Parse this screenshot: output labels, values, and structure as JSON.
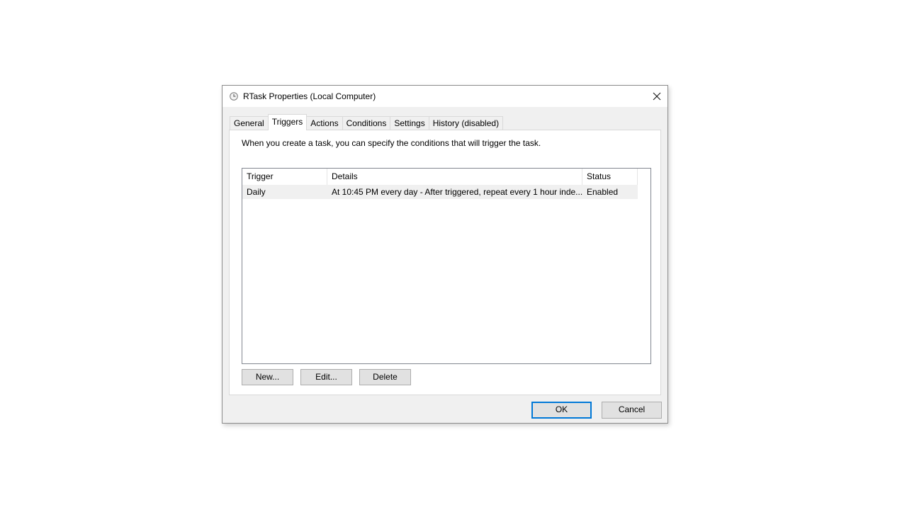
{
  "window": {
    "title": "RTask Properties (Local Computer)",
    "close_symbol": "✕",
    "icon": "clock-icon"
  },
  "tabs": [
    {
      "label": "General",
      "active": false
    },
    {
      "label": "Triggers",
      "active": true
    },
    {
      "label": "Actions",
      "active": false
    },
    {
      "label": "Conditions",
      "active": false
    },
    {
      "label": "Settings",
      "active": false
    },
    {
      "label": "History (disabled)",
      "active": false
    }
  ],
  "triggers_tab": {
    "description": "When you create a task, you can specify the conditions that will trigger the task.",
    "columns": [
      "Trigger",
      "Details",
      "Status"
    ],
    "rows": [
      {
        "trigger": "Daily",
        "details": "At 10:45 PM every day - After triggered, repeat every 1 hour inde...",
        "status": "Enabled"
      }
    ],
    "buttons": {
      "new": "New...",
      "edit": "Edit...",
      "delete": "Delete"
    }
  },
  "footer": {
    "ok": "OK",
    "cancel": "Cancel"
  },
  "colors": {
    "accent": "#0078d7",
    "dialog_bg": "#f0f0f0",
    "selected_row": "#f0f0f0"
  }
}
